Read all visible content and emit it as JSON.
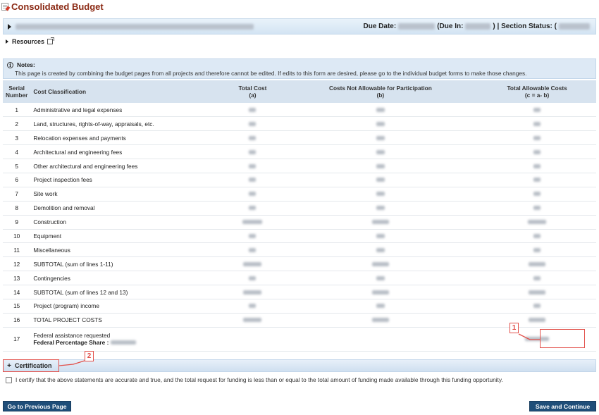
{
  "page": {
    "title": "Consolidated Budget"
  },
  "header": {
    "due_date_label": "Due Date:",
    "due_in_label": "(Due In:",
    "status_label": ") | Section Status: ("
  },
  "resources": {
    "label": "Resources"
  },
  "notes": {
    "title": "Notes:",
    "text": "This page is created by combining the budget pages from all projects and therefore cannot be edited. If edits to this form are desired, please go to the individual budget forms to make those changes."
  },
  "table": {
    "headers": {
      "serial_1": "Serial",
      "serial_2": "Number",
      "classification": "Cost Classification",
      "total_cost": "Total Cost",
      "total_cost_sub": "(a)",
      "not_allowable": "Costs Not Allowable for Participation",
      "not_allowable_sub": "(b)",
      "allowable": "Total Allowable Costs",
      "allowable_sub": "(c = a- b)"
    },
    "rows": [
      {
        "n": "1",
        "label": "Administrative and legal expenses"
      },
      {
        "n": "2",
        "label": "Land, structures, rights-of-way, appraisals, etc."
      },
      {
        "n": "3",
        "label": "Relocation expenses and payments"
      },
      {
        "n": "4",
        "label": "Architectural and engineering fees"
      },
      {
        "n": "5",
        "label": "Other architectural and engineering fees"
      },
      {
        "n": "6",
        "label": "Project inspection fees"
      },
      {
        "n": "7",
        "label": "Site work"
      },
      {
        "n": "8",
        "label": "Demolition and removal"
      },
      {
        "n": "9",
        "label": "Construction"
      },
      {
        "n": "10",
        "label": "Equipment"
      },
      {
        "n": "11",
        "label": "Miscellaneous"
      },
      {
        "n": "12",
        "label": "SUBTOTAL (sum of lines 1-11)"
      },
      {
        "n": "13",
        "label": "Contingencies"
      },
      {
        "n": "14",
        "label": "SUBTOTAL (sum of lines 12 and 13)"
      },
      {
        "n": "15",
        "label": "Project (program) income"
      },
      {
        "n": "16",
        "label": "TOTAL PROJECT COSTS"
      }
    ],
    "row17": {
      "n": "17",
      "label": "Federal assistance requested",
      "share_label": "Federal Percentage Share :"
    }
  },
  "certification": {
    "title": "Certification",
    "statement": "I certify that the above statements are accurate and true, and the total request for funding is less than or equal to the total amount of funding made available through this funding opportunity."
  },
  "buttons": {
    "previous": "Go to Previous Page",
    "save": "Save and Continue"
  },
  "callouts": {
    "one": "1",
    "two": "2"
  },
  "colors": {
    "accent": "#1f4e79",
    "title": "#8b2a14",
    "callout": "#e2504a"
  }
}
